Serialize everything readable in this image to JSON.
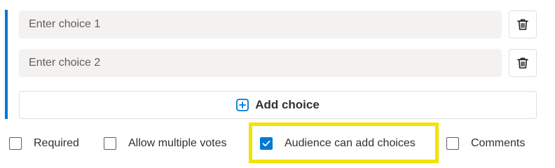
{
  "choices": [
    {
      "placeholder": "Enter choice 1",
      "value": "",
      "delete_icon": "trash-icon"
    },
    {
      "placeholder": "Enter choice 2",
      "value": "",
      "delete_icon": "trash-icon"
    }
  ],
  "add_choice": {
    "label": "Add choice",
    "icon": "plus-square-icon"
  },
  "options": {
    "required": {
      "label": "Required",
      "checked": false
    },
    "allow_multiple_votes": {
      "label": "Allow multiple votes",
      "checked": false
    },
    "audience_can_add_choices": {
      "label": "Audience can add choices",
      "checked": true
    },
    "comments": {
      "label": "Comments",
      "checked": false
    }
  },
  "colors": {
    "accent": "#0078d4",
    "input_background": "#f3f2f1",
    "highlight": "#f2e200"
  }
}
